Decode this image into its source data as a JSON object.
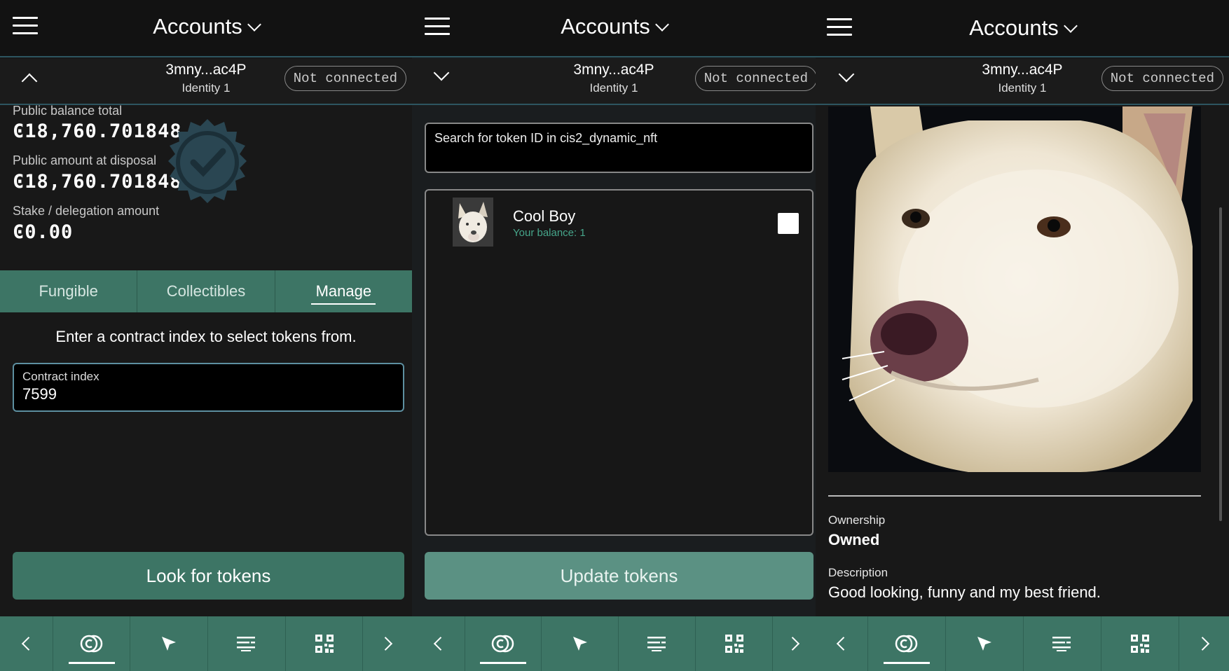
{
  "header": {
    "title": "Accounts"
  },
  "account": {
    "address": "3mny...ac4P",
    "identity": "Identity 1",
    "status": "Not connected"
  },
  "balances": {
    "public_total_label": "Public balance total",
    "public_total_value": "Ͼ18,760.701848",
    "disposal_label": "Public amount at disposal",
    "disposal_value": "Ͼ18,760.701848",
    "stake_label": "Stake / delegation amount",
    "stake_value": "Ͼ0.00"
  },
  "tabs": [
    {
      "label": "Fungible",
      "active": false
    },
    {
      "label": "Collectibles",
      "active": false
    },
    {
      "label": "Manage",
      "active": true
    }
  ],
  "manage": {
    "instruction": "Enter a contract index to select tokens from.",
    "field_label": "Contract index",
    "field_value": "7599",
    "button": "Look for tokens"
  },
  "token_select": {
    "search_placeholder": "Search for token ID in cis2_dynamic_nft",
    "tokens": [
      {
        "name": "Cool Boy",
        "balance": "Your balance: 1",
        "checked": false
      }
    ],
    "button": "Update tokens"
  },
  "nft_detail": {
    "ownership_label": "Ownership",
    "ownership_value": "Owned",
    "description_label": "Description",
    "description_value": "Good looking, funny and my best friend."
  },
  "navbar": {
    "icons": [
      "chevron-left-icon",
      "accounts-icon",
      "send-icon",
      "list-icon",
      "qr-code-icon",
      "chevron-right-icon"
    ],
    "active": "accounts-icon"
  },
  "colors": {
    "accent": "#3d7565",
    "border_accent": "#2d5560",
    "balance_green": "#46a58a"
  }
}
